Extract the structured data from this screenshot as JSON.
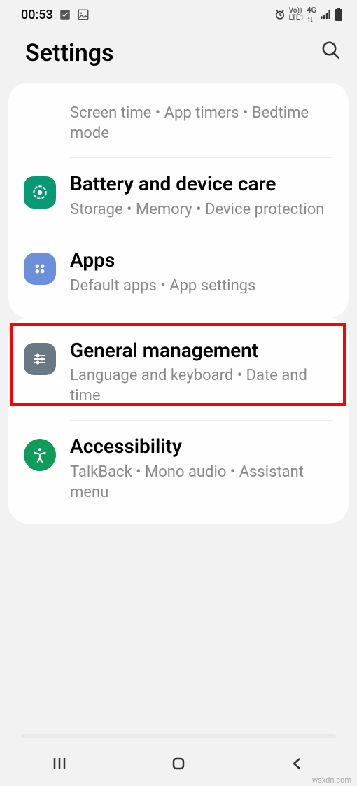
{
  "status": {
    "time": "00:53",
    "network_label": "Vo)) 4G LTE1"
  },
  "header": {
    "title": "Settings"
  },
  "cards": [
    {
      "items": [
        {
          "title": "",
          "sub": "Screen time  •  App timers  •  Bedtime mode"
        },
        {
          "title": "Battery and device care",
          "sub": "Storage  •  Memory  •  Device protection"
        },
        {
          "title": "Apps",
          "sub": "Default apps  •  App settings"
        }
      ]
    },
    {
      "items": [
        {
          "title": "General management",
          "sub": "Language and keyboard  •  Date and time"
        },
        {
          "title": "Accessibility",
          "sub": "TalkBack  •  Mono audio  •  Assistant menu"
        }
      ]
    }
  ],
  "footer": "wsxdn.com"
}
